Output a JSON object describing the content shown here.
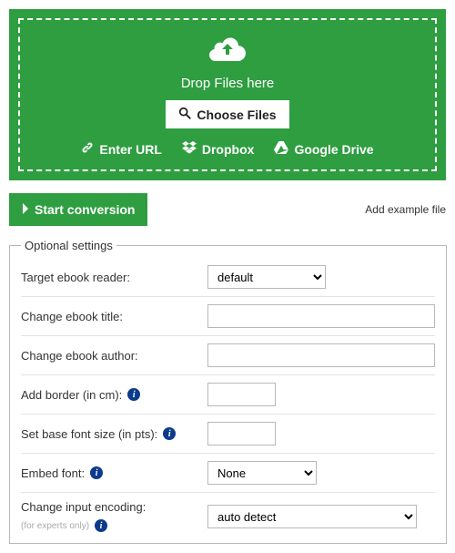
{
  "dropzone": {
    "text": "Drop Files here",
    "choose_label": "Choose Files",
    "sources": {
      "url": "Enter URL",
      "dropbox": "Dropbox",
      "gdrive": "Google Drive"
    }
  },
  "actions": {
    "start": "Start conversion",
    "example": "Add example file"
  },
  "optional": {
    "legend": "Optional settings",
    "target_reader_label": "Target ebook reader:",
    "target_reader_value": "default",
    "title_label": "Change ebook title:",
    "title_value": "",
    "author_label": "Change ebook author:",
    "author_value": "",
    "border_label": "Add border (in cm):",
    "border_value": "",
    "fontsize_label": "Set base font size (in pts):",
    "fontsize_value": "",
    "embed_label": "Embed font:",
    "embed_value": "None",
    "encoding_label": "Change input encoding:",
    "encoding_note": "(for experts only)",
    "encoding_value": "auto detect"
  }
}
